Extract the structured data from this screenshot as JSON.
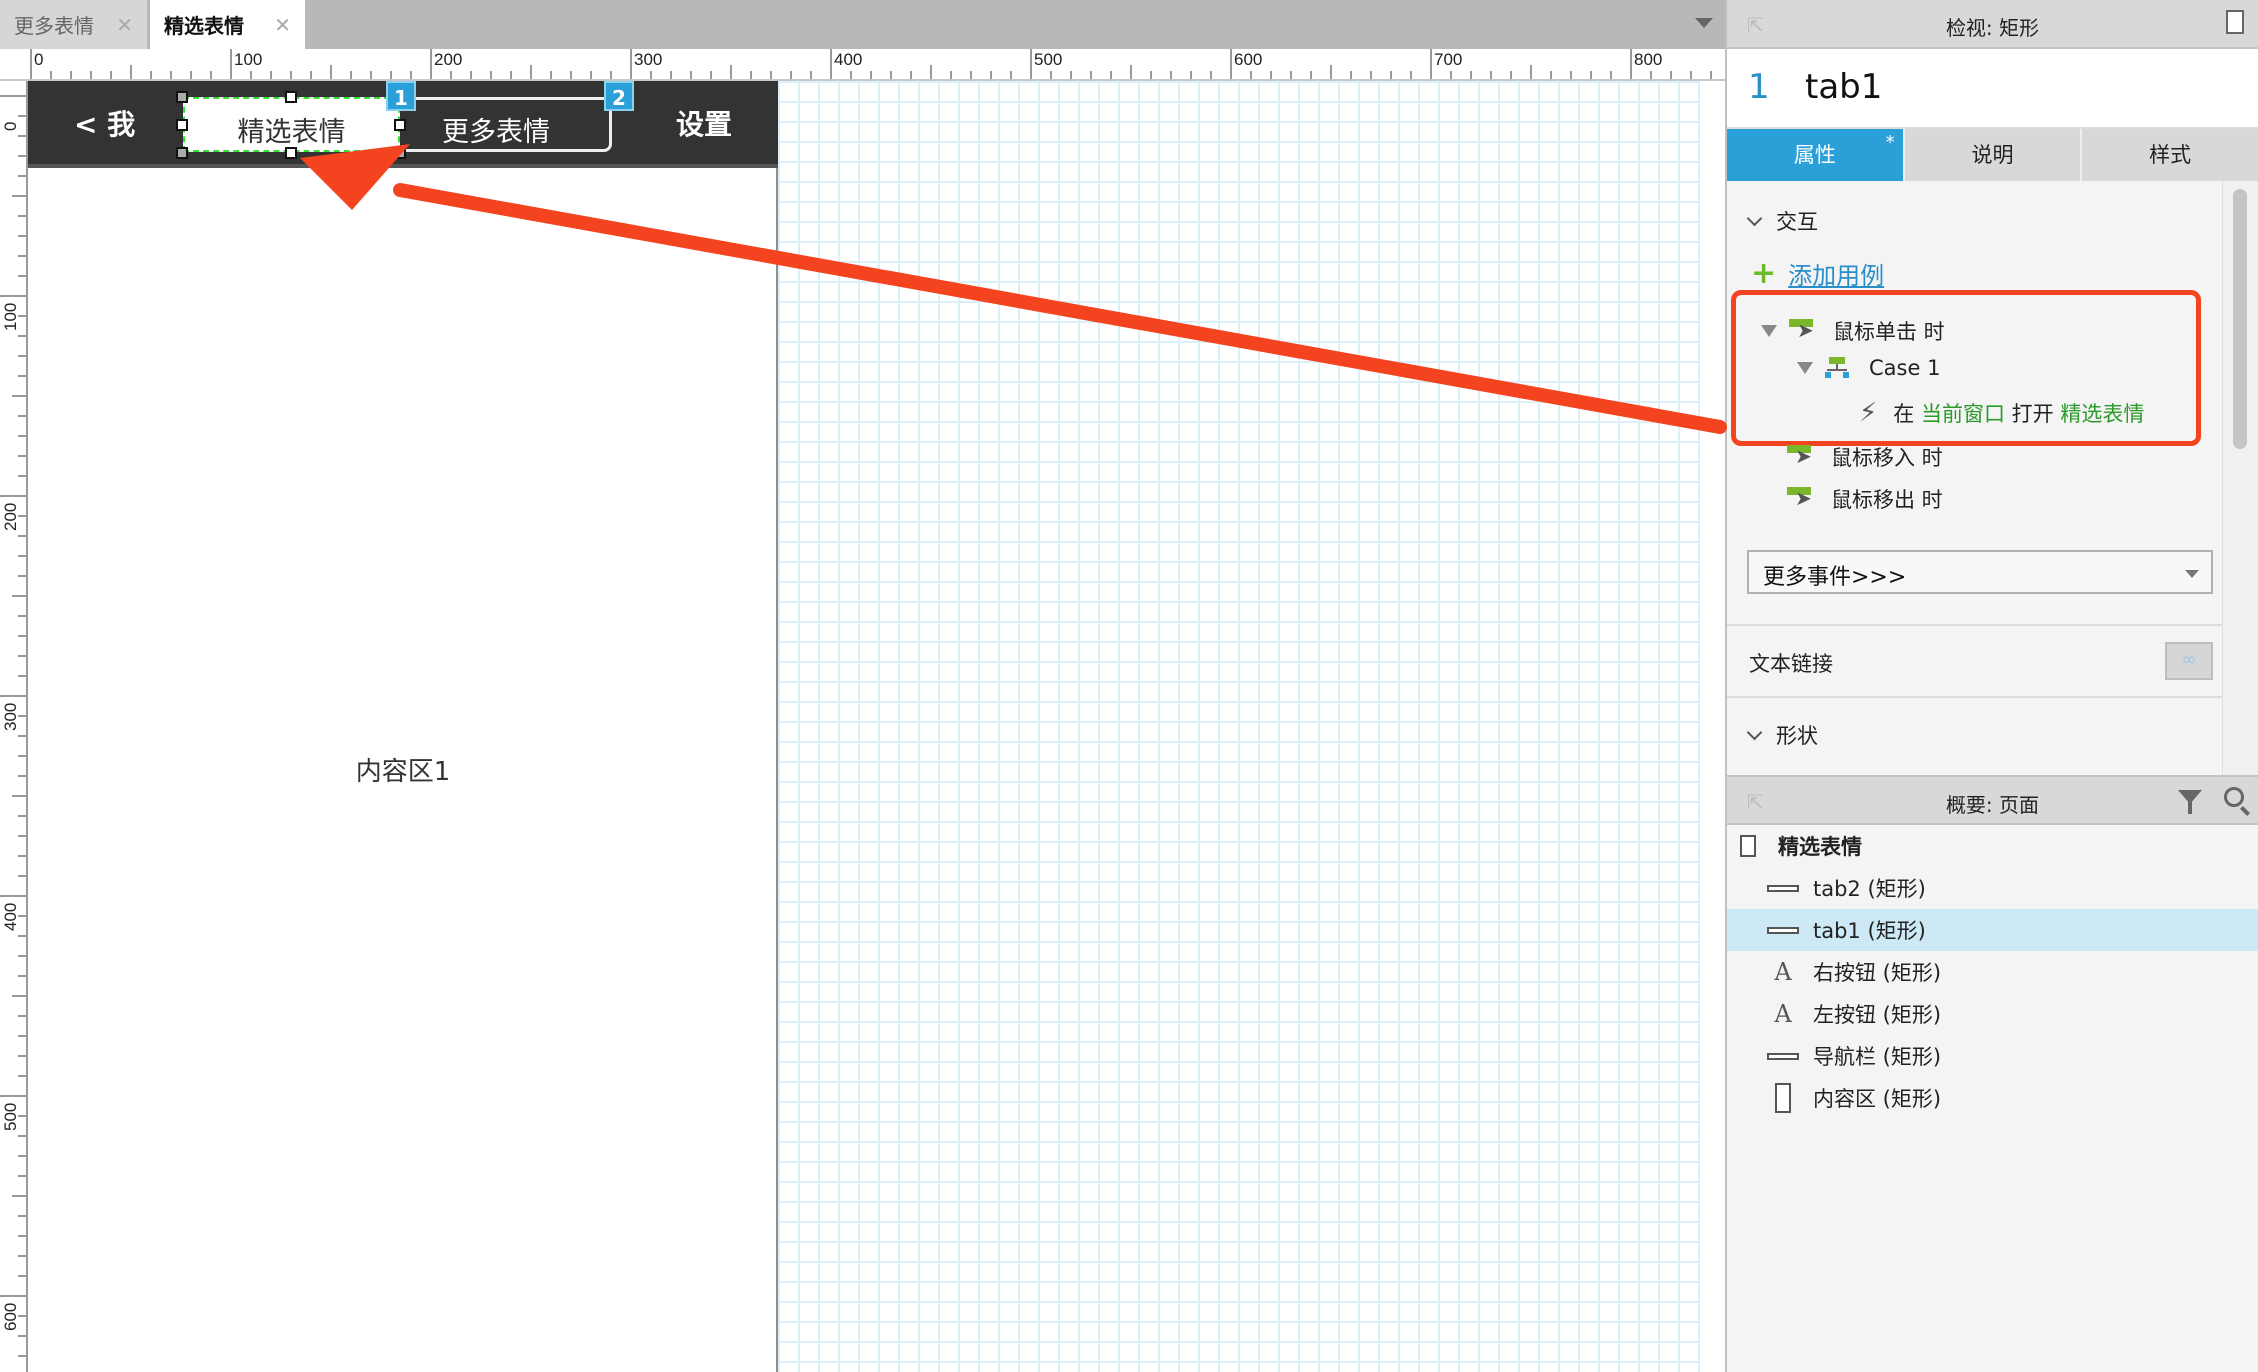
{
  "doc_tabs": [
    {
      "label": "更多表情",
      "active": false
    },
    {
      "label": "精选表情",
      "active": true
    }
  ],
  "rulers": {
    "top_labels": [
      "0",
      "100",
      "200",
      "300",
      "400",
      "500",
      "600",
      "700",
      "800"
    ],
    "left_labels": [
      "0",
      "100",
      "200",
      "300",
      "400",
      "500",
      "600"
    ]
  },
  "canvas": {
    "nav_left": "< 我",
    "nav_right": "设置",
    "tab1_label": "精选表情",
    "tab2_label": "更多表情",
    "tab1_badge": "1",
    "tab2_badge": "2",
    "content_label": "内容区1"
  },
  "inspector": {
    "title": "检视: 矩形",
    "widget_index": "1",
    "widget_name": "tab1",
    "tabs": [
      {
        "label": "属性",
        "active": true,
        "modified": "*"
      },
      {
        "label": "说明",
        "active": false
      },
      {
        "label": "样式",
        "active": false
      }
    ],
    "interaction_section": "交互",
    "add_case": "添加用例",
    "events": [
      {
        "label": "鼠标单击 时",
        "expanded": true
      },
      {
        "label": "鼠标移入 时"
      },
      {
        "label": "鼠标移出 时"
      }
    ],
    "case": {
      "label": "Case 1"
    },
    "action": {
      "prefix": "在",
      "target": "当前窗口",
      "verb": "打开",
      "page": "精选表情"
    },
    "more_events": "更多事件>>>",
    "text_link": "文本链接",
    "shape_section": "形状"
  },
  "outline": {
    "title": "概要: 页面",
    "page": "精选表情",
    "items": [
      {
        "label": "tab2 (矩形)",
        "icon": "rect",
        "selected": false
      },
      {
        "label": "tab1 (矩形)",
        "icon": "rect",
        "selected": true
      },
      {
        "label": "右按钮 (矩形)",
        "icon": "text",
        "selected": false
      },
      {
        "label": "左按钮 (矩形)",
        "icon": "text",
        "selected": false
      },
      {
        "label": "导航栏 (矩形)",
        "icon": "rect",
        "selected": false
      },
      {
        "label": "内容区 (矩形)",
        "icon": "tall",
        "selected": false
      }
    ]
  },
  "colors": {
    "accent": "#2a9fd8",
    "annotation": "#f4431f",
    "action_green": "#2a9a2a",
    "selection_dash": "#2ee62e"
  }
}
